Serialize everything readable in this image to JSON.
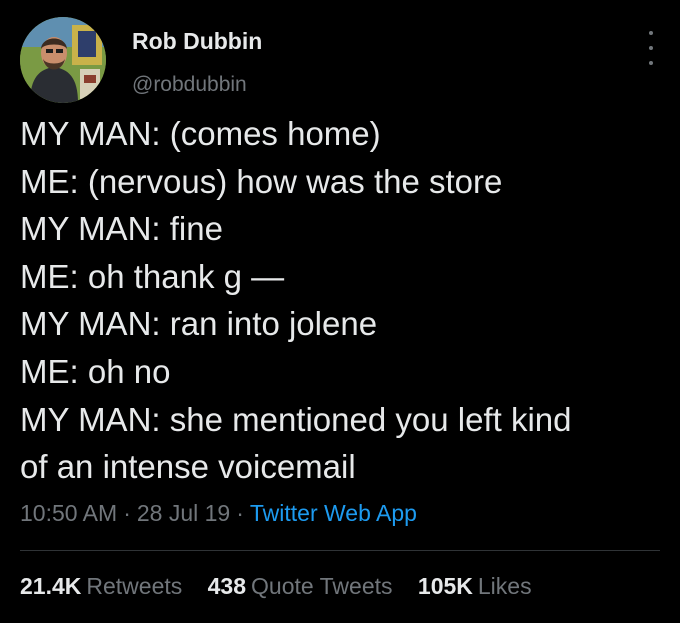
{
  "author": {
    "name": "Rob Dubbin",
    "handle": "@robdubbin",
    "avatar_icon": "painted-portrait-avatar"
  },
  "tweet": {
    "lines": [
      "MY MAN: (comes home)",
      "ME: (nervous) how was the store",
      "MY MAN: fine",
      "ME: oh thank g —",
      "MY MAN: ran into jolene",
      "ME: oh no",
      "MY MAN: she mentioned you left kind",
      "of an intense voicemail"
    ]
  },
  "meta": {
    "time": "10:50 AM",
    "separator": "·",
    "date": "28 Jul 19",
    "source": "Twitter Web App"
  },
  "stats": {
    "retweets_count": "21.4K",
    "retweets_label": "Retweets",
    "quotes_count": "438",
    "quotes_label": "Quote Tweets",
    "likes_count": "105K",
    "likes_label": "Likes"
  },
  "colors": {
    "background": "#000000",
    "text": "#e7e9ea",
    "secondary": "#71767b",
    "link": "#1d9bf0",
    "divider": "#2f3336"
  }
}
